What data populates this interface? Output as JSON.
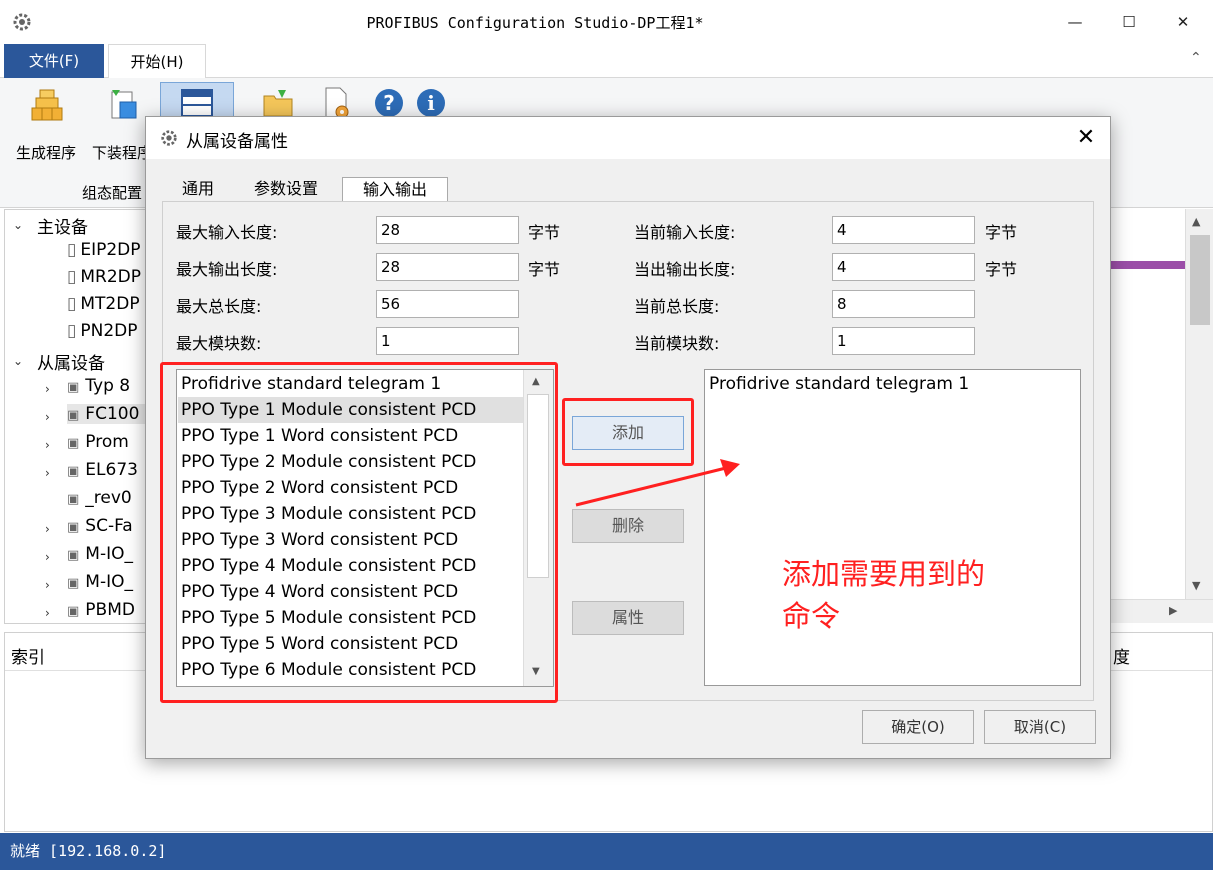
{
  "window": {
    "title": "PROFIBUS Configuration Studio-DP工程1*",
    "minimize": "—",
    "maximize": "☐",
    "close": "✕"
  },
  "ribbon": {
    "tabs": [
      "文件(F)",
      "开始(H)"
    ],
    "buttons": [
      {
        "label": "生成程序",
        "icon": "build-program-icon"
      },
      {
        "label": "下装程序",
        "icon": "download-program-icon"
      }
    ],
    "group_label": "组态配置",
    "collapse": "⌃"
  },
  "tree": {
    "master_header": "主设备",
    "masters": [
      "EIP2DP",
      "MR2DP",
      "MT2DP",
      "PN2DP"
    ],
    "slave_header": "从属设备",
    "slaves": [
      "Typ 8",
      "FC100",
      "Prom",
      "EL673",
      "_rev0",
      "SC-Fa",
      "M-IO_",
      "M-IO_",
      "PBMD"
    ]
  },
  "bottom_panel": {
    "index_label": "索引",
    "length_label": "度"
  },
  "status_bar": {
    "text": "就绪 [192.168.0.2]"
  },
  "dialog": {
    "title": "从属设备属性",
    "tabs": [
      "通用",
      "参数设置",
      "输入输出"
    ],
    "fields": {
      "max_input_label": "最大输入长度:",
      "max_input_value": "28",
      "max_output_label": "最大输出长度:",
      "max_output_value": "28",
      "max_total_label": "最大总长度:",
      "max_total_value": "56",
      "max_modules_label": "最大模块数:",
      "max_modules_value": "1",
      "cur_input_label": "当前输入长度:",
      "cur_input_value": "4",
      "cur_output_label": "当出输出长度:",
      "cur_output_value": "4",
      "cur_total_label": "当前总长度:",
      "cur_total_value": "8",
      "cur_modules_label": "当前模块数:",
      "cur_modules_value": "1",
      "unit": "字节"
    },
    "module_list": [
      "Profidrive standard telegram 1",
      "PPO Type 1 Module consistent PCD",
      "PPO Type 1 Word consistent PCD",
      "PPO Type 2 Module consistent PCD",
      "PPO Type 2 Word consistent PCD",
      "PPO Type 3 Module consistent PCD",
      "PPO Type 3 Word consistent PCD",
      "PPO Type 4 Module consistent PCD",
      "PPO Type 4 Word consistent PCD",
      "PPO Type 5 Module consistent PCD",
      "PPO Type 5 Word consistent PCD",
      "PPO Type 6 Module consistent PCD"
    ],
    "selected_module_index": 1,
    "configured_modules": [
      "Profidrive standard telegram 1"
    ],
    "buttons": {
      "add": "添加",
      "delete": "删除",
      "properties": "属性",
      "ok": "确定(O)",
      "cancel": "取消(C)"
    },
    "annotation_line1": "添加需要用到的",
    "annotation_line2": "命令"
  },
  "colors": {
    "accent_blue": "#2b579a",
    "annotation_red": "#ff2020",
    "purple_bar": "#9b4ea8"
  }
}
